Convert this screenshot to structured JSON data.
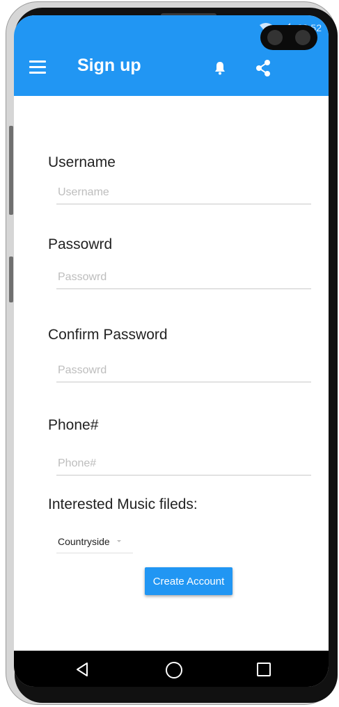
{
  "status_bar": {
    "time": "23:52"
  },
  "app_bar": {
    "title": "Sign up",
    "icons": [
      "menu-icon",
      "bell-icon",
      "share-icon"
    ]
  },
  "form": {
    "username": {
      "label": "Username",
      "placeholder": "Username",
      "value": ""
    },
    "password": {
      "label": "Passowrd",
      "placeholder": "Passowrd",
      "value": ""
    },
    "confirm_password": {
      "label": "Confirm Password",
      "placeholder": "Passowrd",
      "value": ""
    },
    "phone": {
      "label": "Phone#",
      "placeholder": "Phone#",
      "value": ""
    },
    "music": {
      "label": "Interested Music fileds:",
      "selected": "Countryside"
    },
    "submit_label": "Create Account"
  },
  "nav_bar": {
    "icons": [
      "back-icon",
      "home-icon",
      "recent-apps-icon"
    ]
  },
  "colors": {
    "accent": "#2196f3",
    "label_text": "#222222",
    "placeholder": "#bdbdbd",
    "nav_bar": "#000000"
  }
}
